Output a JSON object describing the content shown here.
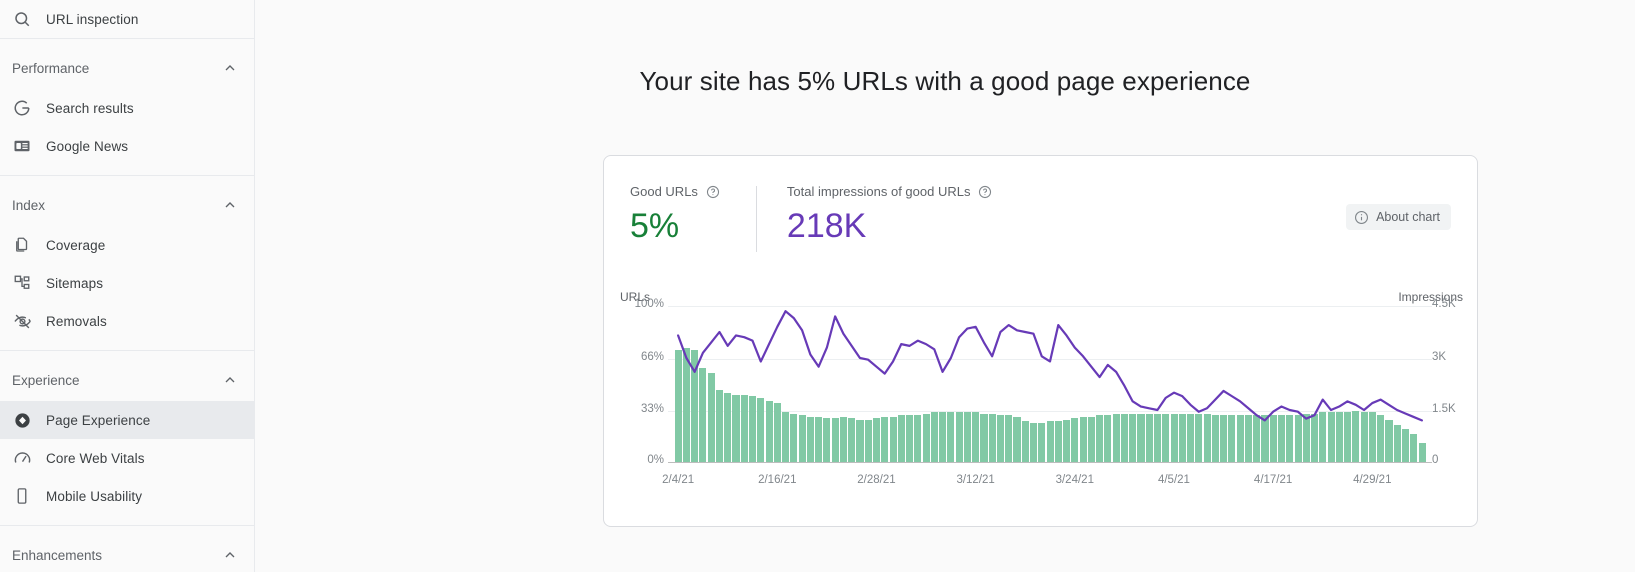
{
  "sidebar": {
    "top_item": {
      "label": "URL inspection",
      "icon": "search-icon"
    },
    "sections": [
      {
        "id": "performance",
        "label": "Performance",
        "collapse_icon": "chevron-up-icon",
        "items": [
          {
            "id": "search-results",
            "label": "Search results",
            "icon": "google-g-icon"
          },
          {
            "id": "google-news",
            "label": "Google News",
            "icon": "news-card-icon"
          }
        ]
      },
      {
        "id": "index",
        "label": "Index",
        "collapse_icon": "chevron-up-icon",
        "items": [
          {
            "id": "coverage",
            "label": "Coverage",
            "icon": "pages-icon"
          },
          {
            "id": "sitemaps",
            "label": "Sitemaps",
            "icon": "sitemap-icon"
          },
          {
            "id": "removals",
            "label": "Removals",
            "icon": "eye-off-icon"
          }
        ]
      },
      {
        "id": "experience",
        "label": "Experience",
        "collapse_icon": "chevron-up-icon",
        "items": [
          {
            "id": "page-experience",
            "label": "Page Experience",
            "icon": "diamond-badge-icon",
            "active": true
          },
          {
            "id": "core-web-vitals",
            "label": "Core Web Vitals",
            "icon": "speedometer-icon"
          },
          {
            "id": "mobile-usability",
            "label": "Mobile Usability",
            "icon": "mobile-phone-icon"
          }
        ]
      },
      {
        "id": "enhancements",
        "label": "Enhancements",
        "collapse_icon": "chevron-up-icon",
        "items": []
      }
    ]
  },
  "main": {
    "page_title": "Your site has 5% URLs with a good page experience",
    "card": {
      "metrics": [
        {
          "id": "good-urls",
          "label": "Good URLs",
          "value": "5%",
          "color": "#188038",
          "help_icon": "help-circle-icon"
        },
        {
          "id": "total-impressions-good-urls",
          "label": "Total impressions of good URLs",
          "value": "218K",
          "color": "#673ab7",
          "help_icon": "help-circle-icon"
        }
      ],
      "about_chart_button": {
        "label": "About chart",
        "icon": "info-circle-icon"
      }
    }
  },
  "chart_data": {
    "type": "bar",
    "title": "",
    "xlabel": "",
    "ylabel": "URLs",
    "y2label": "Impressions",
    "grid": true,
    "legend_position": "none",
    "bar_color": "#81c9a5",
    "line_color": "#673ab7",
    "ylim": [
      0,
      100
    ],
    "yticks": [
      "0%",
      "33%",
      "66%",
      "100%"
    ],
    "ytick_values": [
      0,
      33,
      66,
      100
    ],
    "y2lim": [
      0,
      4500
    ],
    "y2ticks": [
      "0",
      "1.5K",
      "3K",
      "4.5K"
    ],
    "y2tick_values": [
      0,
      1500,
      3000,
      4500
    ],
    "xticks": [
      "2/4/21",
      "2/16/21",
      "2/28/21",
      "3/12/21",
      "3/24/21",
      "4/5/21",
      "4/17/21",
      "4/29/21"
    ],
    "xtick_indices": [
      0,
      12,
      24,
      36,
      48,
      60,
      72,
      84
    ],
    "x_start_date": "2/4/21",
    "x_end_date": "5/5/21",
    "series": [
      {
        "name": "Good URLs",
        "axis": "left",
        "unit": "%",
        "type": "bar",
        "values": [
          72,
          73,
          72,
          60,
          57,
          46,
          44,
          43,
          43,
          42,
          41,
          39,
          38,
          32,
          31,
          30,
          29,
          29,
          28,
          28,
          29,
          28,
          27,
          27,
          28,
          29,
          29,
          30,
          30,
          30,
          31,
          32,
          32,
          32,
          32,
          32,
          32,
          31,
          31,
          30,
          30,
          29,
          26,
          25,
          25,
          26,
          26,
          27,
          28,
          29,
          29,
          30,
          30,
          31,
          31,
          31,
          31,
          31,
          31,
          31,
          31,
          31,
          31,
          31,
          31,
          30,
          30,
          30,
          30,
          30,
          30,
          30,
          30,
          30,
          30,
          30,
          31,
          31,
          32,
          32,
          32,
          32,
          33,
          32,
          32,
          30,
          27,
          24,
          21,
          18,
          12
        ]
      },
      {
        "name": "Impressions",
        "axis": "right",
        "unit": "impressions",
        "type": "line",
        "values": [
          3650,
          3000,
          2600,
          3150,
          3450,
          3750,
          3350,
          3650,
          3600,
          3500,
          2900,
          3400,
          3900,
          4350,
          4150,
          3800,
          3100,
          2750,
          3300,
          4200,
          3700,
          3350,
          3000,
          2950,
          2750,
          2550,
          2900,
          3400,
          3350,
          3500,
          3400,
          3250,
          2600,
          3000,
          3600,
          3850,
          3900,
          3450,
          3050,
          3750,
          3950,
          3800,
          3750,
          3700,
          3050,
          2900,
          3950,
          3650,
          3300,
          3050,
          2750,
          2450,
          2800,
          2600,
          2200,
          1750,
          1600,
          1550,
          1500,
          1850,
          2000,
          1900,
          1650,
          1450,
          1550,
          1800,
          2050,
          1900,
          1750,
          1550,
          1350,
          1200,
          1450,
          1600,
          1500,
          1450,
          1250,
          1350,
          1800,
          1500,
          1600,
          1750,
          1650,
          1500,
          1700,
          1800,
          1650,
          1500,
          1400,
          1300,
          1200
        ]
      }
    ]
  }
}
